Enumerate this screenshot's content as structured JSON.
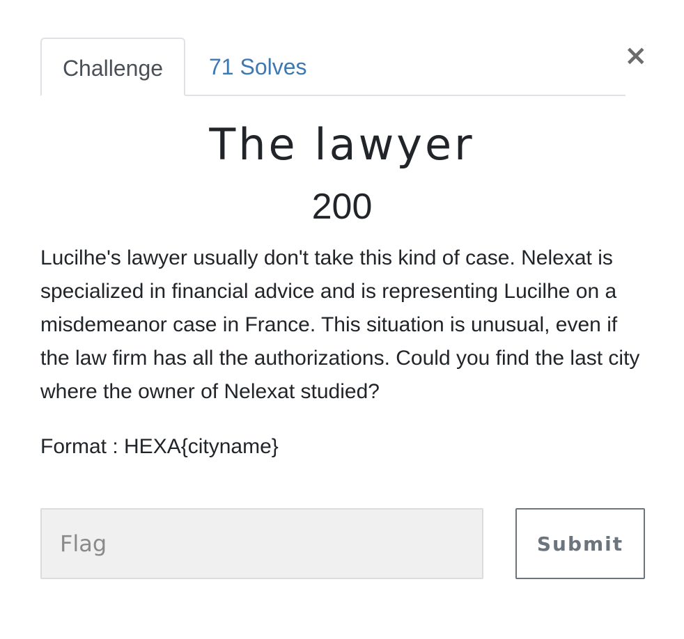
{
  "modal": {
    "close_symbol": "×",
    "tabs": [
      {
        "label": "Challenge"
      },
      {
        "label": "71 Solves"
      }
    ],
    "challenge": {
      "name": "The lawyer",
      "points": "200",
      "description": "Lucilhe's lawyer usually don't take this kind of case. Nelexat is specialized in financial advice and is representing Lucilhe on a misdemeanor case in France. This situation is unusual, even if the law firm has all the authorizations. Could you find the last city where the owner of Nelexat studied?",
      "format": "Format : HEXA{cityname}"
    },
    "form": {
      "flag_placeholder": "Flag",
      "flag_value": "",
      "submit_label": "Submit"
    }
  },
  "colors": {
    "link": "#3e78b3",
    "text": "#212529",
    "input_bg": "#f0f0f0",
    "button_border": "#6c757d"
  },
  "icons": {
    "close": "close-icon"
  }
}
